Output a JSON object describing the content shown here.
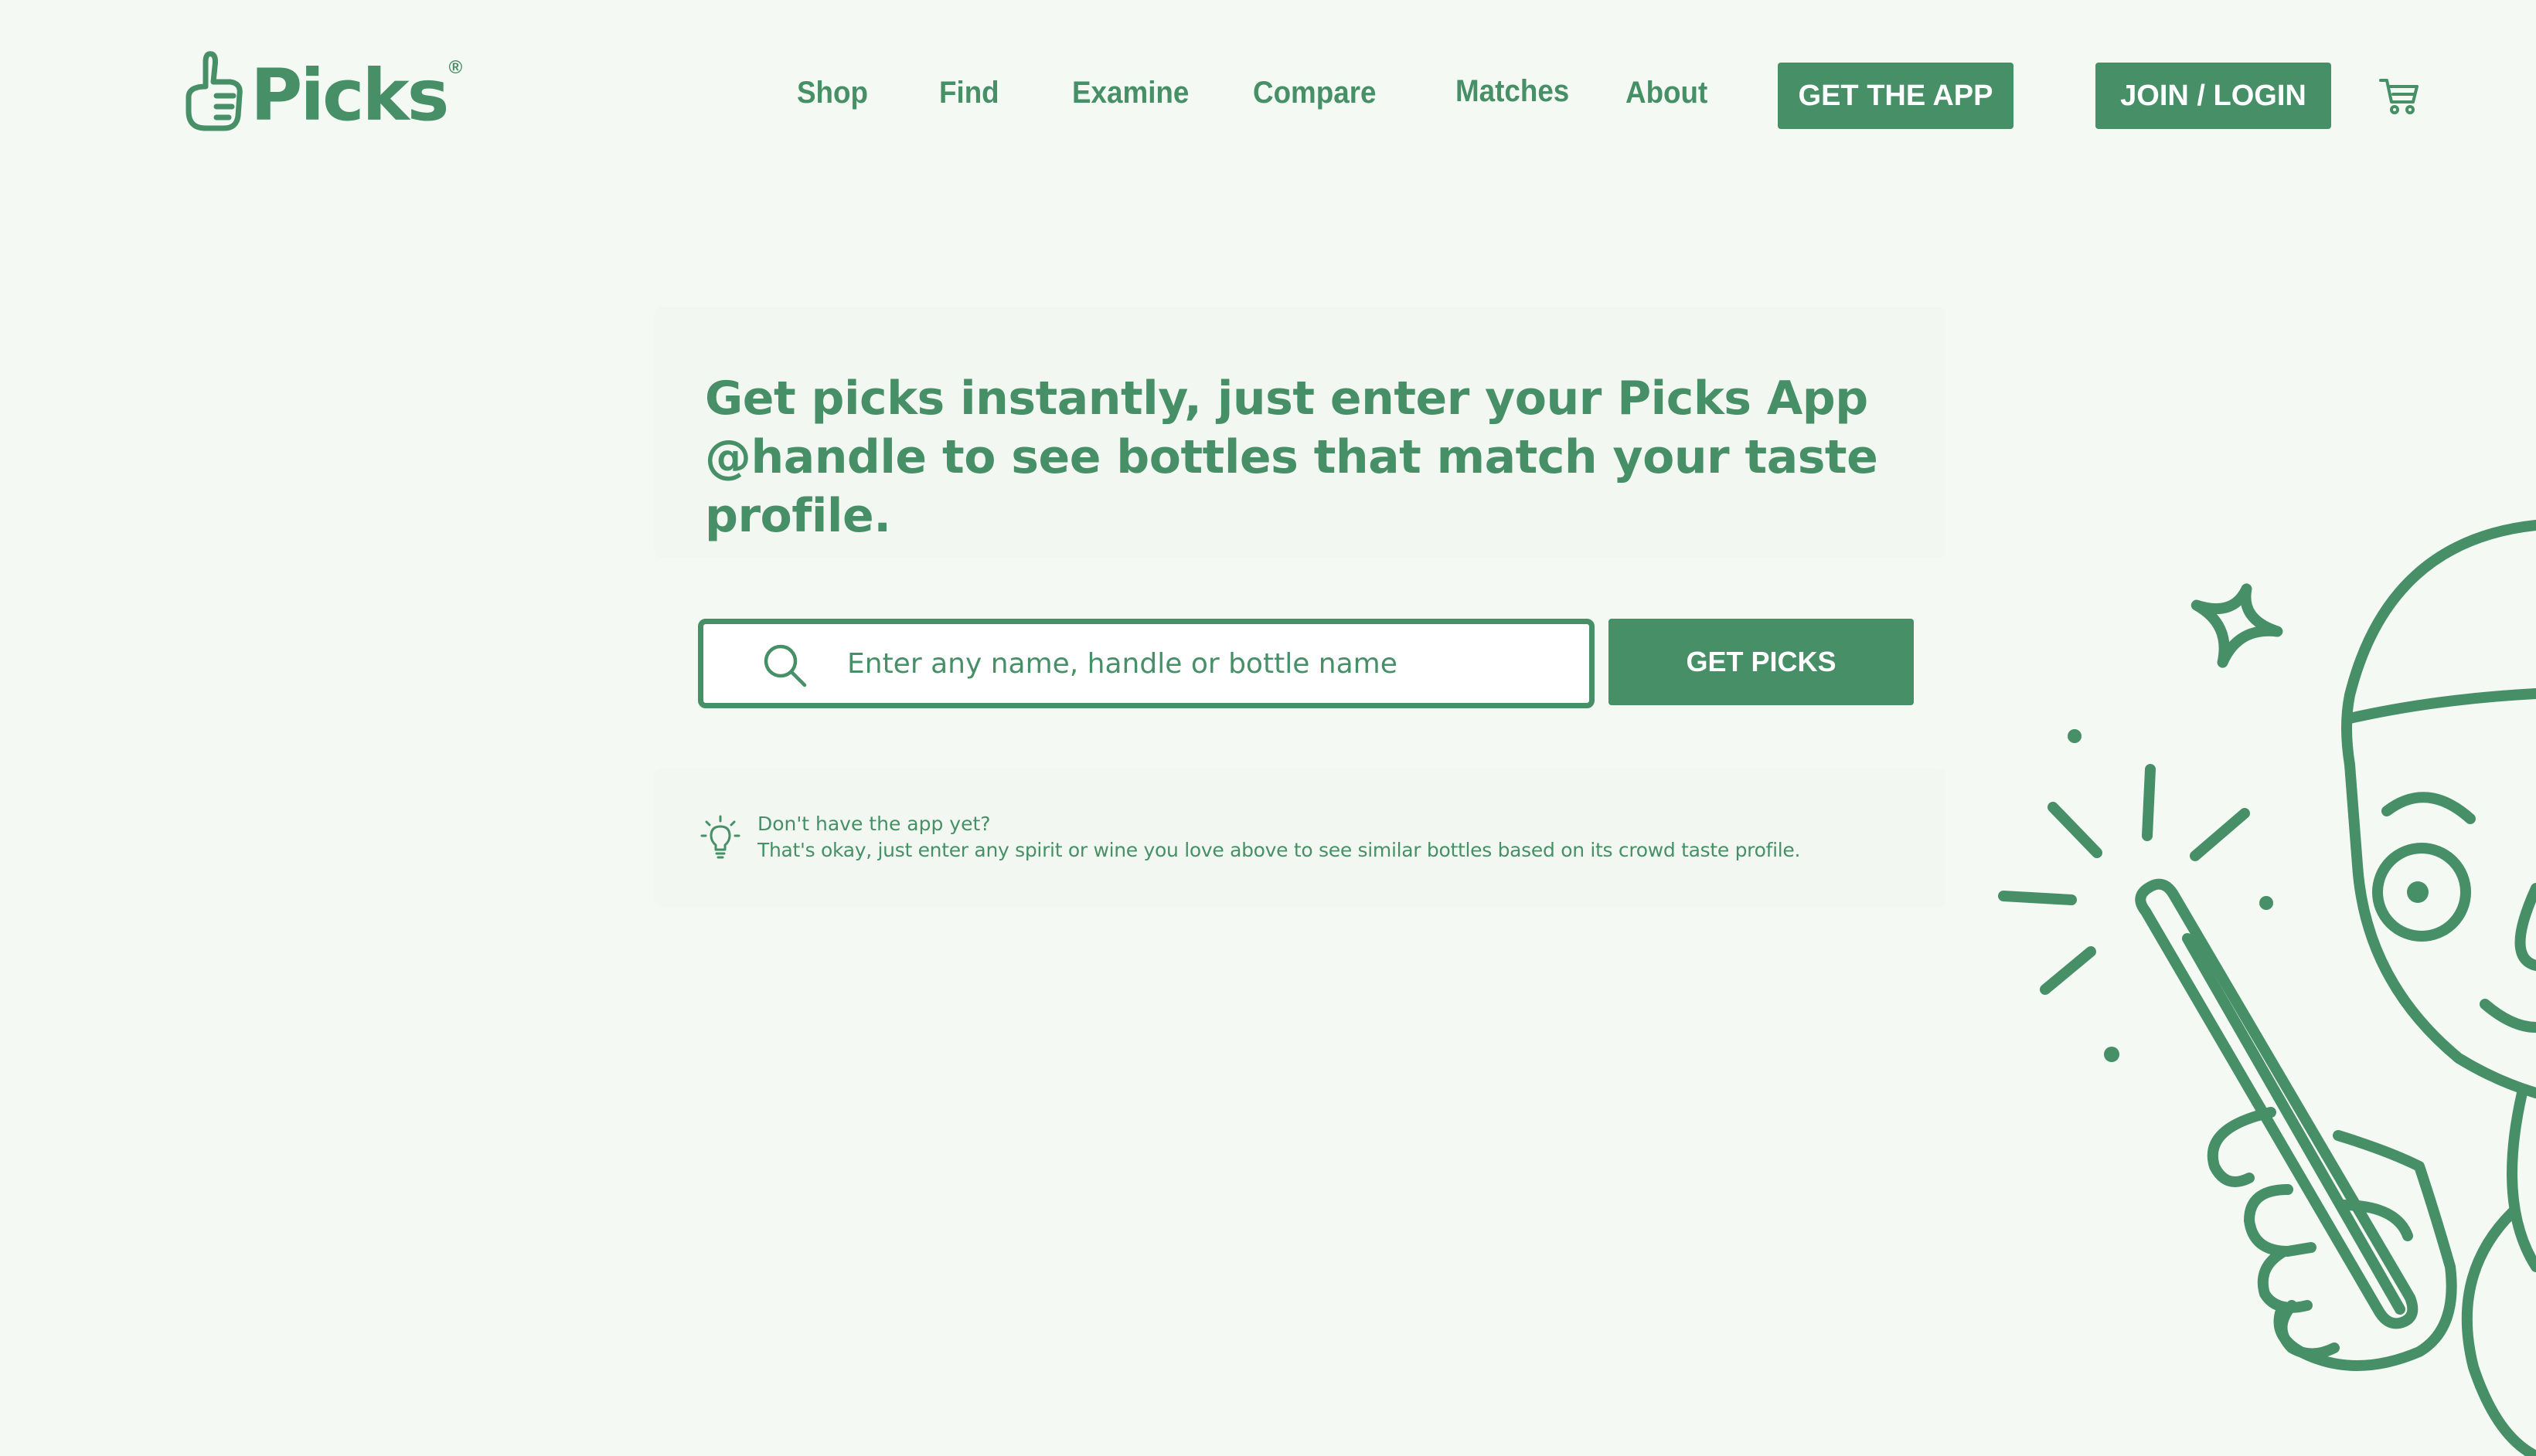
{
  "brand": {
    "name": "Picks",
    "registered_mark": "®",
    "color": "#468f67",
    "background": "#f4f9f3"
  },
  "nav": {
    "links": [
      {
        "label": "Shop"
      },
      {
        "label": "Find"
      },
      {
        "label": "Examine"
      },
      {
        "label": "Compare"
      },
      {
        "label": "Matches"
      },
      {
        "label": "About"
      }
    ],
    "get_app_label": "GET THE APP",
    "login_label": "JOIN / LOGIN",
    "cart_icon": "cart-icon"
  },
  "hero": {
    "headline": "Get picks instantly, just enter your Picks App @handle to see bottles that match your taste profile."
  },
  "search": {
    "icon": "search-icon",
    "placeholder": "Enter any name, handle or bottle name",
    "value": "",
    "button_label": "GET PICKS"
  },
  "tip": {
    "icon": "lightbulb-icon",
    "title": "Don't have the app yet?",
    "body": "That's okay, just enter any spirit or wine you love above to see similar bottles based on its crowd taste profile."
  },
  "illustration": {
    "icon": "mascot-with-magic-wand-illustration"
  }
}
